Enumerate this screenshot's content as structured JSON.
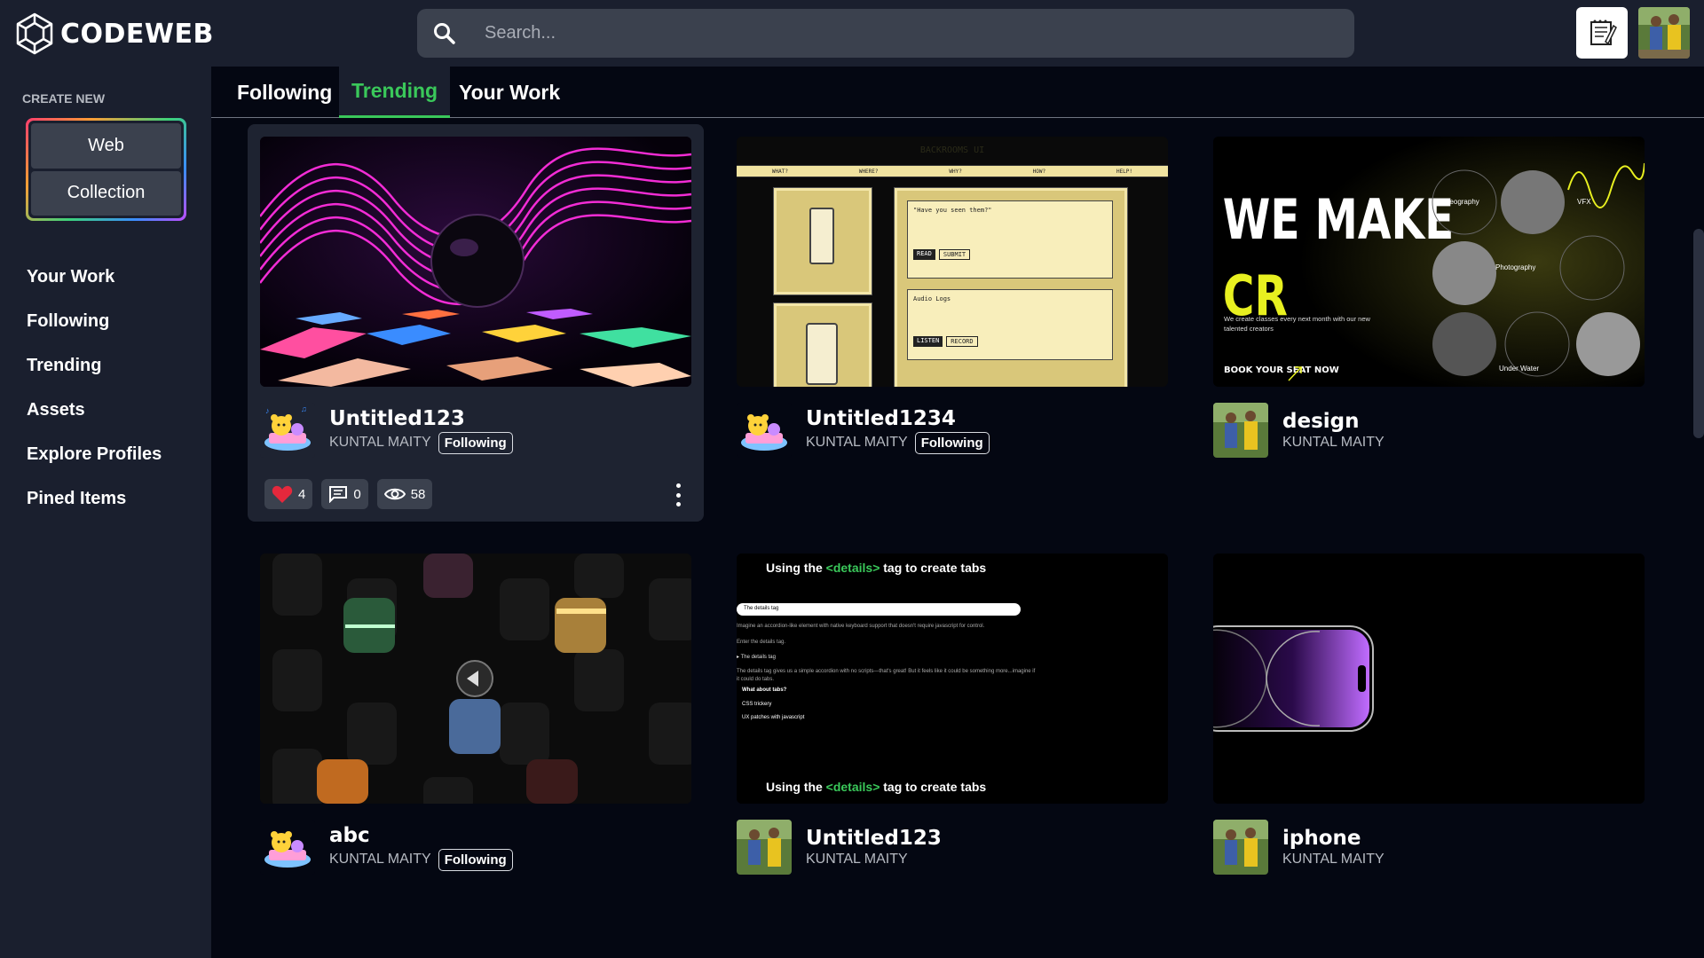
{
  "app": {
    "name": "CODEWEB"
  },
  "search": {
    "placeholder": "Search..."
  },
  "sidebar": {
    "create_label": "CREATE NEW",
    "create_buttons": [
      "Web",
      "Collection"
    ],
    "nav_items": [
      "Your Work",
      "Following",
      "Trending",
      "Assets",
      "Explore Profiles",
      "Pined Items"
    ]
  },
  "tabs": [
    "Following",
    "Trending",
    "Your Work"
  ],
  "active_tab": "Trending",
  "cards": [
    {
      "title": "Untitled123",
      "author": "KUNTAL MAITY",
      "badge": "Following",
      "likes": "4",
      "comments": "0",
      "views": "58"
    },
    {
      "title": "Untitled1234",
      "author": "KUNTAL MAITY",
      "badge": "Following",
      "preview": {
        "header": "BACKROOMS UI",
        "menu": [
          "WHAT?",
          "WHERE?",
          "WHY?",
          "HOW?",
          "HELP!"
        ],
        "q": "\"Have you seen them?\"",
        "btn1": "READ",
        "btn2": "SUBMIT",
        "audio": "Audio Logs",
        "btn3": "LISTEN",
        "btn4": "RECORD"
      }
    },
    {
      "title": "design",
      "author": "KUNTAL MAITY",
      "preview": {
        "line1": "WE MAKE",
        "line2": "CR",
        "sub": "We create classes every next month with our new talented creators",
        "cta": "BOOK YOUR SEAT NOW",
        "l1": "Videography",
        "l2": "VFX",
        "l3": "Photography",
        "l4": "Under Water"
      }
    },
    {
      "title": "abc",
      "author": "KUNTAL MAITY",
      "badge": "Following"
    },
    {
      "title": "Untitled123",
      "author": "KUNTAL MAITY",
      "preview": {
        "pre": "Using the ",
        "tag": "<details>",
        "post": " tag to create tabs",
        "pill": "The details tag",
        "l1": "Imagine an accordion-like element with native keyboard support that doesn't require javascript for control.",
        "l2": "Enter the details tag.",
        "l3": "▸ The details tag",
        "l4": "The details tag gives us a simple accordion with no scripts—that's great! But it feels like it could be something more...imagine if it could do tabs.",
        "l5": "What about tabs?",
        "l6": "CSS trickery",
        "l7": "UX patches with javascript"
      }
    },
    {
      "title": "iphone",
      "author": "KUNTAL MAITY"
    }
  ],
  "colors": {
    "accent": "#3ac85a",
    "surface": "#1a1f2e",
    "background": "#040712",
    "like": "#e5283c"
  }
}
